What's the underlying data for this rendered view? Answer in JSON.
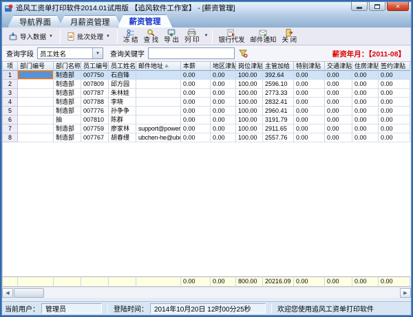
{
  "window": {
    "title": "追风工资单打印软件2014.01试用版 【追风软件工作室】 - [薪资管理]"
  },
  "tabs": [
    {
      "label": "导航界面",
      "active": false
    },
    {
      "label": "月薪资管理",
      "active": false
    },
    {
      "label": "薪资管理",
      "active": true
    }
  ],
  "toolbar": {
    "import": "导入数据",
    "batch": "批次处理",
    "freeze": "冻 结",
    "find": "查 找",
    "export": "导 出",
    "print": "列 印",
    "bank": "银行代发",
    "mail": "邮件通知",
    "close": "关 闭"
  },
  "query": {
    "field_label": "查询字段",
    "field_value": "员工姓名",
    "keyword_label": "查询关键字",
    "keyword_value": "",
    "period": "薪资年月：【2011-08】"
  },
  "colors": {
    "period_text": "#e10000",
    "selected_cell": "#4f94e0",
    "selected_cell_border": "#d8792f",
    "totals_row_bg": "#ffffe1",
    "close_button": "#c43a1e"
  },
  "table": {
    "columns": [
      "项",
      "部门编号",
      "部门名称",
      "员工编号",
      "员工姓名",
      "邮件地址",
      "本薪",
      "地区津贴",
      "岗位津贴",
      "主管加给",
      "特别津贴",
      "交通津贴",
      "住房津贴",
      "签约津贴"
    ],
    "sorted_column": "邮件地址",
    "rows": [
      {
        "idx": "1",
        "dept_no": "",
        "dept": "制造部",
        "emp_no": "007750",
        "name": "石自锋",
        "email": "",
        "vals": [
          "0.00",
          "0.00",
          "100.00",
          "392.64",
          "0.00",
          "0.00",
          "0.00",
          "0.00"
        ]
      },
      {
        "idx": "2",
        "dept_no": "",
        "dept": "制造部",
        "emp_no": "007809",
        "name": "邱方园",
        "email": "",
        "vals": [
          "0.00",
          "0.00",
          "100.00",
          "2596.10",
          "0.00",
          "0.00",
          "0.00",
          "0.00"
        ]
      },
      {
        "idx": "3",
        "dept_no": "",
        "dept": "制造部",
        "emp_no": "007787",
        "name": "朱林娃",
        "email": "",
        "vals": [
          "0.00",
          "0.00",
          "100.00",
          "2773.33",
          "0.00",
          "0.00",
          "0.00",
          "0.00"
        ]
      },
      {
        "idx": "4",
        "dept_no": "",
        "dept": "制造部",
        "emp_no": "007788",
        "name": "李晓",
        "email": "",
        "vals": [
          "0.00",
          "0.00",
          "100.00",
          "2832.41",
          "0.00",
          "0.00",
          "0.00",
          "0.00"
        ]
      },
      {
        "idx": "5",
        "dept_no": "",
        "dept": "制造部",
        "emp_no": "007776",
        "name": "孙争争",
        "email": "",
        "vals": [
          "0.00",
          "0.00",
          "100.00",
          "2960.41",
          "0.00",
          "0.00",
          "0.00",
          "0.00"
        ]
      },
      {
        "idx": "6",
        "dept_no": "",
        "dept": "抽",
        "emp_no": "007810",
        "name": "陈群",
        "email": "",
        "vals": [
          "0.00",
          "0.00",
          "100.00",
          "3191.79",
          "0.00",
          "0.00",
          "0.00",
          "0.00"
        ]
      },
      {
        "idx": "7",
        "dept_no": "",
        "dept": "制造部",
        "emp_no": "007759",
        "name": "廖家林",
        "email": "support@poweroffice",
        "vals": [
          "0.00",
          "0.00",
          "100.00",
          "2911.65",
          "0.00",
          "0.00",
          "0.00",
          "0.00"
        ]
      },
      {
        "idx": "8",
        "dept_no": "",
        "dept": "制造部",
        "emp_no": "007767",
        "name": "胡春缦",
        "email": "ubchen-he@ubos.cn",
        "vals": [
          "0.00",
          "0.00",
          "100.00",
          "2557.76",
          "0.00",
          "0.00",
          "0.00",
          "0.00"
        ]
      }
    ],
    "totals": [
      "0.00",
      "0.00",
      "800.00",
      "20216.09",
      "0.00",
      "0.00",
      "0.00",
      "0.00"
    ]
  },
  "statusbar": {
    "user_label": "当前用户：",
    "user_value": "管理员",
    "login_label": "登陆时间：",
    "login_value": "2014年10月20日  12时00分25秒",
    "welcome": "欢迎您使用追风工资单打印软件"
  }
}
